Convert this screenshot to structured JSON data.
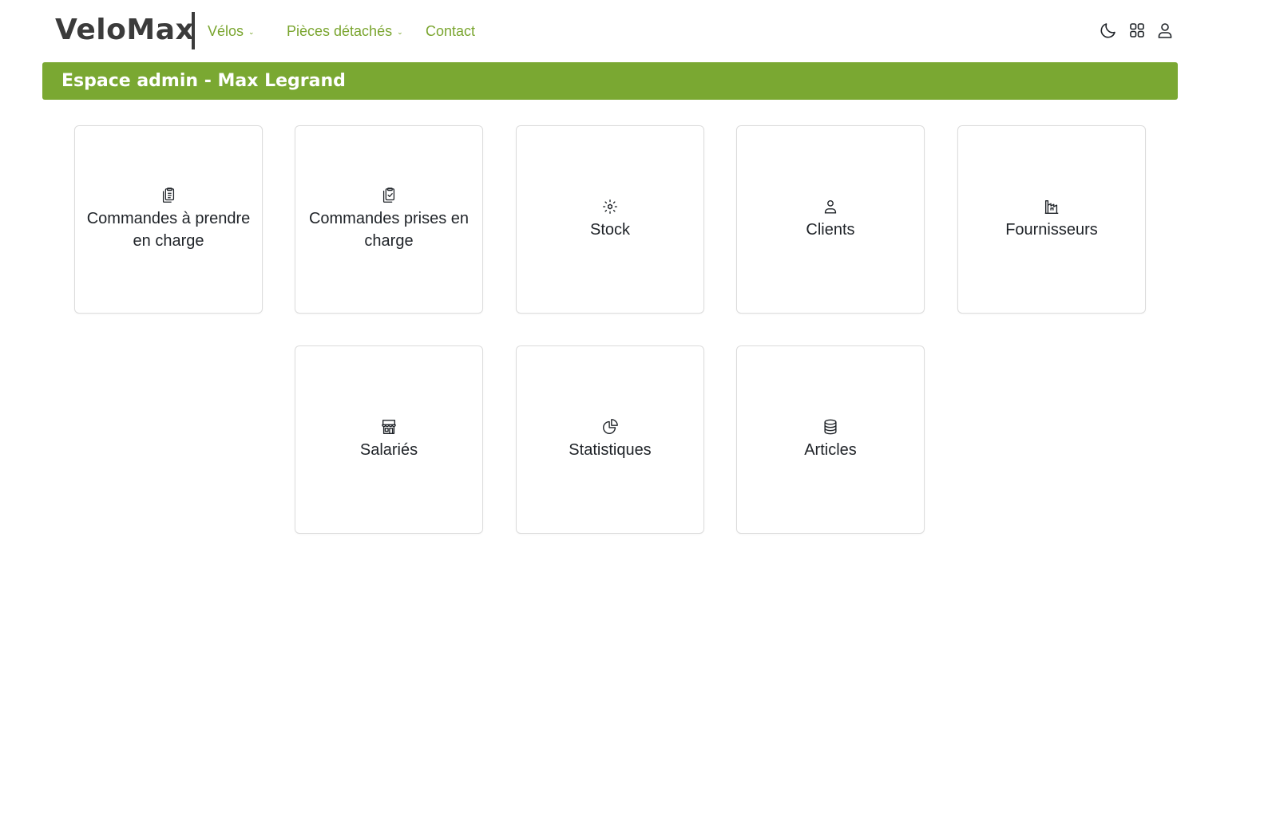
{
  "brand": {
    "name": "VeloMax"
  },
  "nav": {
    "velos": "Vélos",
    "pieces": "Pièces détachés",
    "contact": "Contact"
  },
  "toolbar": {
    "icons": [
      "moon-icon",
      "apps-grid-icon",
      "user-icon"
    ]
  },
  "banner": {
    "title": "Espace admin - Max Legrand"
  },
  "tiles": [
    {
      "label": "Commandes à prendre en charge",
      "icon": "clipboard-list-icon"
    },
    {
      "label": "Commandes prises en charge",
      "icon": "clipboard-check-icon"
    },
    {
      "label": "Stock",
      "icon": "box-icon"
    },
    {
      "label": "Clients",
      "icon": "user-icon"
    },
    {
      "label": "Fournisseurs",
      "icon": "factory-icon"
    },
    {
      "label": "Salariés",
      "icon": "store-icon"
    },
    {
      "label": "Statistiques",
      "icon": "pie-chart-icon"
    },
    {
      "label": "Articles",
      "icon": "database-icon"
    }
  ],
  "colors": {
    "accent": "#7aa832",
    "text": "#1f2328",
    "logo": "#3b3b3b"
  }
}
